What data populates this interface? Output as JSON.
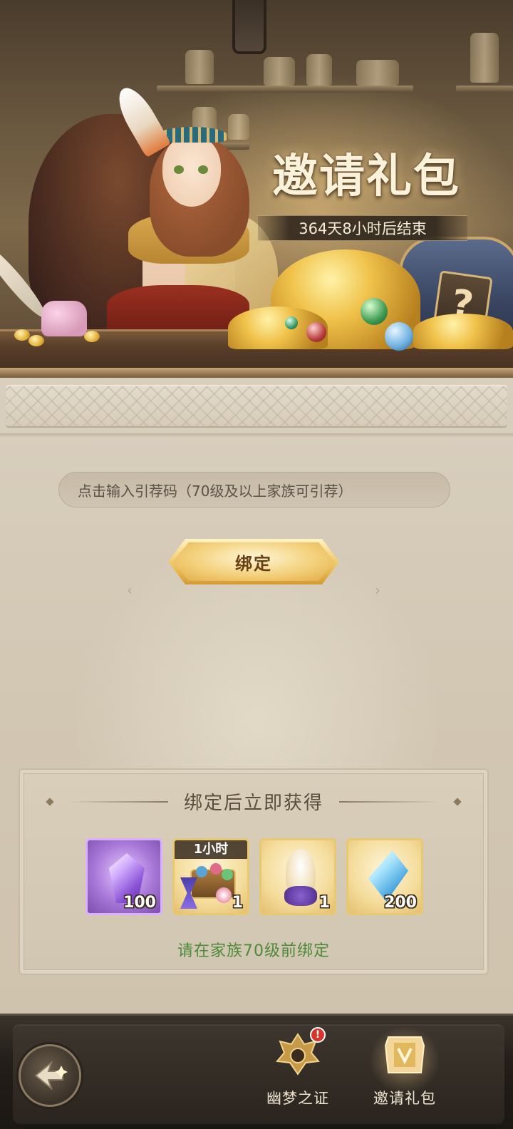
{
  "banner": {
    "title": "邀请礼包",
    "timer": "364天8小时后结束"
  },
  "invite": {
    "placeholder": "点击输入引荐码（70级及以上家族可引荐）",
    "bind_button": "绑定"
  },
  "rewards": {
    "title": "绑定后立即获得",
    "items": [
      {
        "icon": "purple-crystal-icon",
        "quantity": "100",
        "tag": ""
      },
      {
        "icon": "treasure-chest-icon",
        "quantity": "1",
        "tag": "1小时"
      },
      {
        "icon": "spirit-flame-icon",
        "quantity": "1",
        "tag": ""
      },
      {
        "icon": "blue-crystal-icon",
        "quantity": "200",
        "tag": ""
      }
    ],
    "notice": "请在家族70级前绑定",
    "notice_color": "#4e8a3a"
  },
  "nav": {
    "items": [
      {
        "label": "幽梦之证",
        "badge": "!"
      },
      {
        "label": "邀请礼包"
      }
    ]
  }
}
